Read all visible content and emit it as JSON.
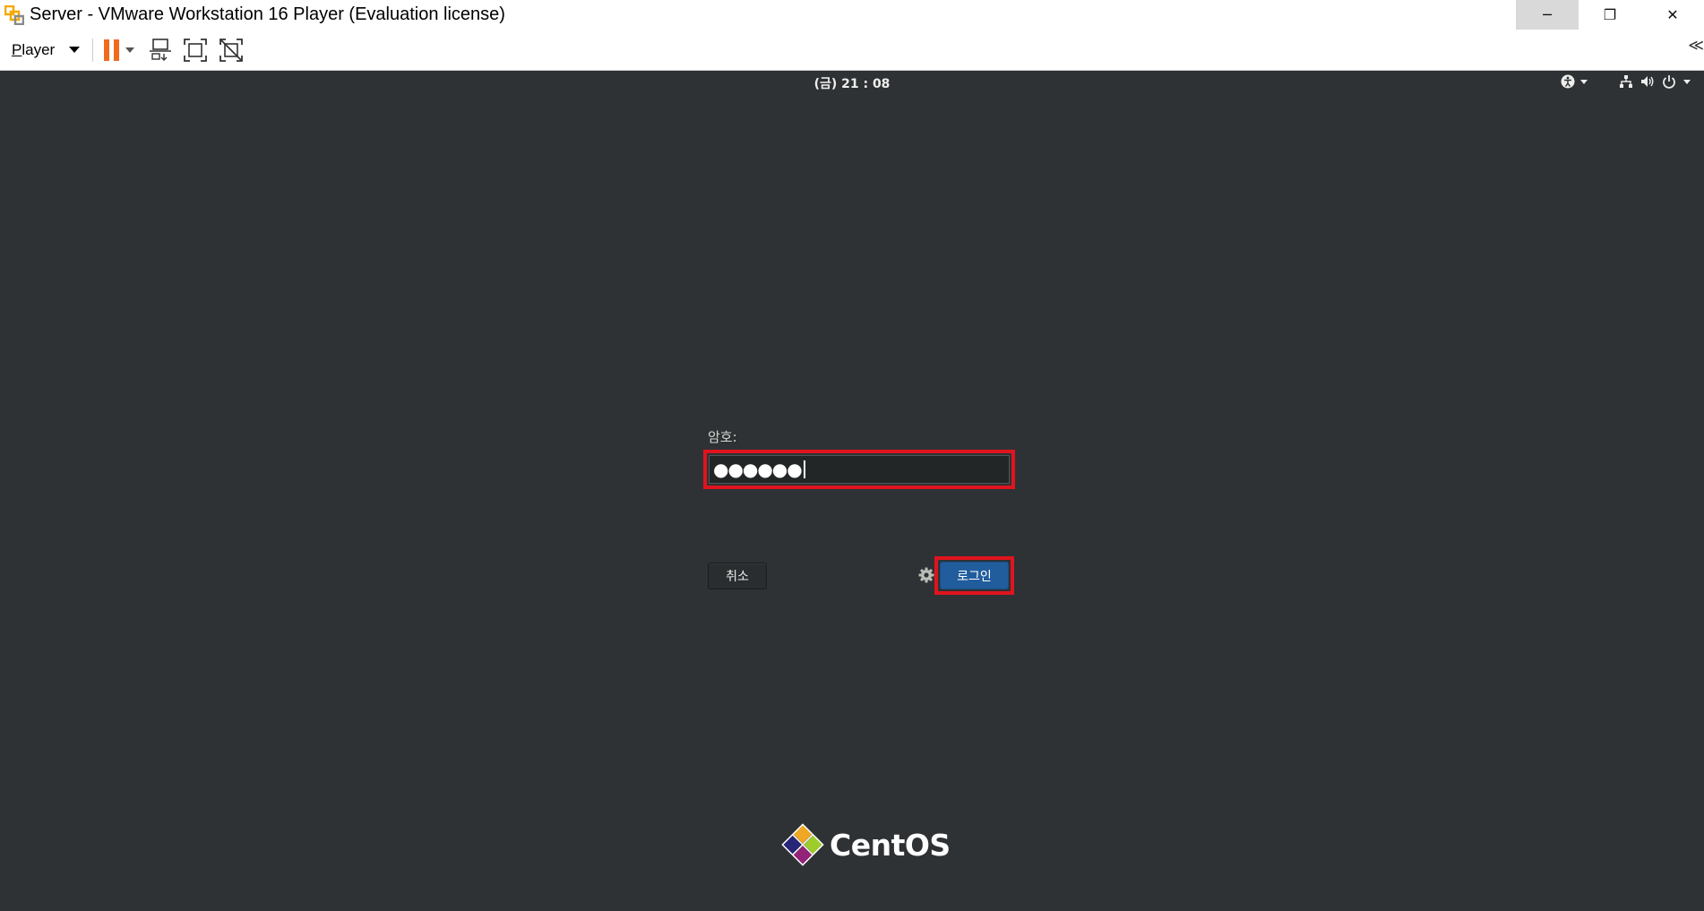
{
  "window": {
    "title": "Server - VMware Workstation 16 Player (Evaluation license)",
    "controls": {
      "minimize": "─",
      "restore": "❐",
      "close": "✕"
    }
  },
  "toolbar": {
    "player_menu": {
      "first_letter": "P",
      "rest": "layer"
    },
    "icons": [
      "pause-icon",
      "send-ctrl-alt-del-icon",
      "full-screen-icon",
      "unity-icon"
    ],
    "collapse": "≪"
  },
  "guest": {
    "topbar": {
      "clock": "(금) 21 : 08"
    },
    "login": {
      "password_label": "암호:",
      "password_value": "●●●●●●",
      "cancel_label": "취소",
      "login_label": "로그인"
    },
    "branding": {
      "logo_text": "CentOS"
    }
  },
  "colors": {
    "guest_background": "#2e3235",
    "highlight": "#e0141e",
    "login_button": "#215d9c",
    "pause_orange": "#f06a1e"
  }
}
